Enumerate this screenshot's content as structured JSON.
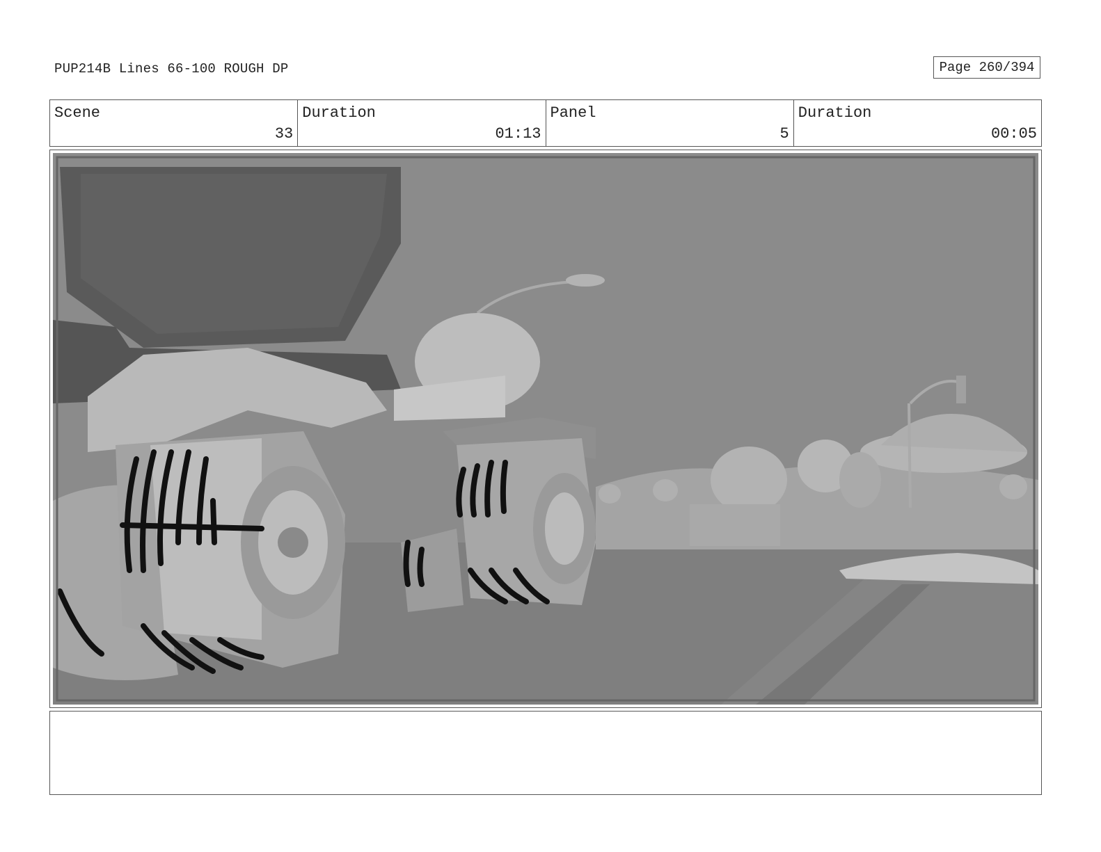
{
  "header": {
    "title": "PUP214B Lines 66-100 ROUGH DP",
    "page": "Page 260/394"
  },
  "info": {
    "scene_label": "Scene",
    "scene_value": "33",
    "scene_duration_label": "Duration",
    "scene_duration_value": "01:13",
    "panel_label": "Panel",
    "panel_value": "5",
    "panel_duration_label": "Duration",
    "panel_duration_value": "00:05"
  },
  "panel_image": {
    "icon": "storyboard-frame-truck-wheels-town",
    "colors": {
      "sky": "#8a8a8a",
      "ground": "#7e7e7e",
      "truck": "#9a9a9a",
      "lines": "#111111"
    }
  },
  "notes": {
    "text": ""
  }
}
